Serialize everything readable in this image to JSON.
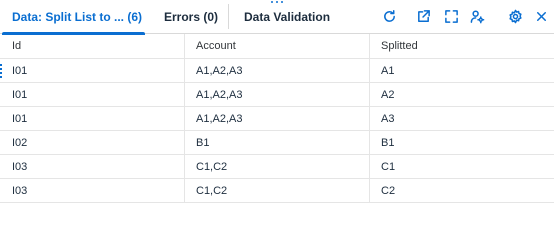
{
  "tabs": [
    {
      "label": "Data: Split List to ... (6)"
    },
    {
      "label": "Errors (0)"
    },
    {
      "label": "Data Validation"
    }
  ],
  "toolbar": {
    "icons": [
      "refresh-icon",
      "export-icon",
      "expand-icon",
      "user-settings-icon",
      "settings-icon",
      "close-icon"
    ]
  },
  "table": {
    "columns": [
      "Id",
      "Account",
      "Splitted"
    ],
    "rows": [
      [
        "I01",
        "A1,A2,A3",
        "A1"
      ],
      [
        "I01",
        "A1,A2,A3",
        "A2"
      ],
      [
        "I01",
        "A1,A2,A3",
        "A3"
      ],
      [
        "I02",
        "B1",
        "B1"
      ],
      [
        "I03",
        "C1,C2",
        "C1"
      ],
      [
        "I03",
        "C1,C2",
        "C2"
      ]
    ]
  },
  "colors": {
    "accent": "#0a6ed1",
    "text": "#1d2d3e",
    "border": "#e5e5e5"
  }
}
